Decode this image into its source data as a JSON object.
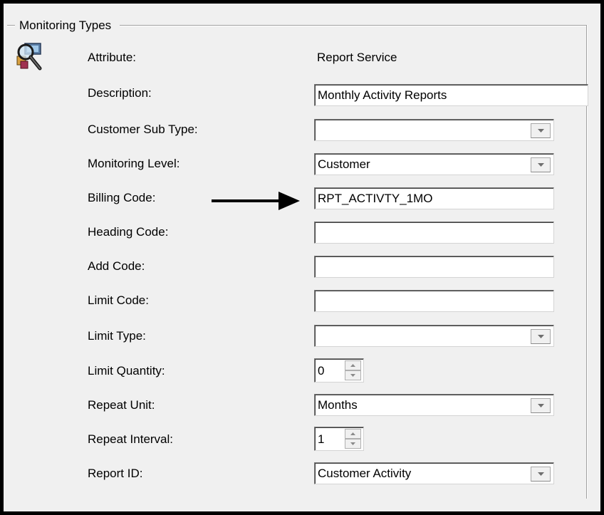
{
  "group": {
    "title": "Monitoring Types"
  },
  "fields": {
    "attribute": {
      "label": "Attribute:",
      "value": "Report Service"
    },
    "description": {
      "label": "Description:",
      "value": "Monthly Activity Reports"
    },
    "customer_sub_type": {
      "label": "Customer Sub Type:",
      "value": ""
    },
    "monitoring_level": {
      "label": "Monitoring Level:",
      "value": "Customer"
    },
    "billing_code": {
      "label": "Billing Code:",
      "value": "RPT_ACTIVTY_1MO"
    },
    "heading_code": {
      "label": "Heading Code:",
      "value": ""
    },
    "add_code": {
      "label": "Add Code:",
      "value": ""
    },
    "limit_code": {
      "label": "Limit Code:",
      "value": ""
    },
    "limit_type": {
      "label": "Limit Type:",
      "value": ""
    },
    "limit_quantity": {
      "label": "Limit Quantity:",
      "value": "0"
    },
    "repeat_unit": {
      "label": "Repeat Unit:",
      "value": "Months"
    },
    "repeat_interval": {
      "label": "Repeat Interval:",
      "value": "1"
    },
    "report_id": {
      "label": "Report ID:",
      "value": "Customer Activity"
    }
  },
  "icons": {
    "app": "monitoring-magnifier-icon",
    "annotation": "black-arrow-right-icon"
  },
  "colors": {
    "frame": "#000000",
    "background": "#f0f0f0",
    "field": "#ffffff"
  }
}
